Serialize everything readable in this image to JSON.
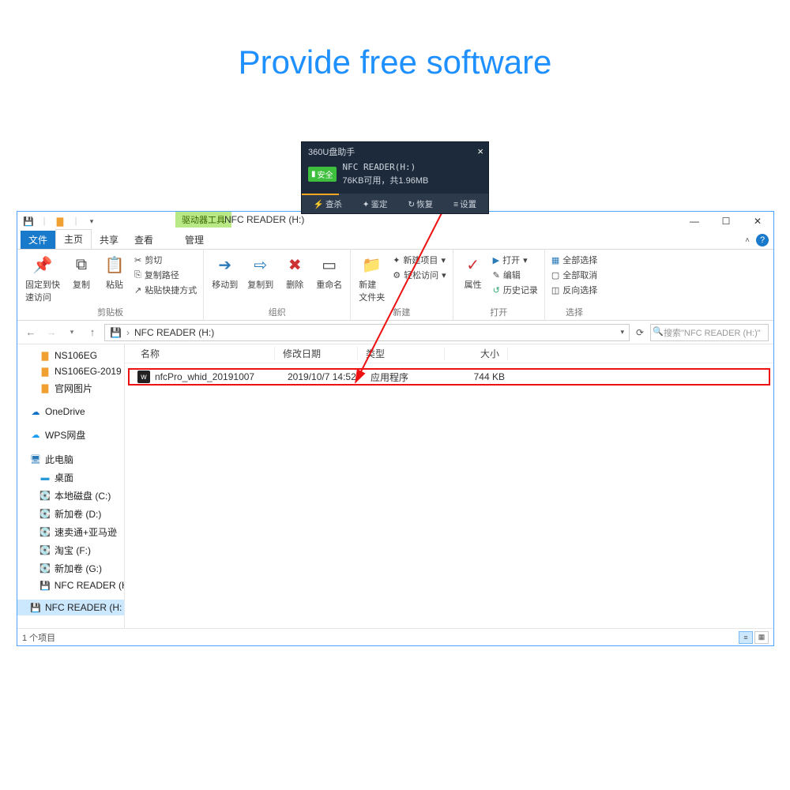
{
  "heading": "Provide free software",
  "popup": {
    "title": "360U盘助手",
    "badge": "安全",
    "line1": "NFC READER(H:)",
    "line2": "76KB可用，共1.96MB",
    "actions": {
      "scan": "查杀",
      "identify": "鉴定",
      "restore": "恢复",
      "settings": "设置"
    }
  },
  "window": {
    "driveToolsLabel": "驱动器工具",
    "title": "NFC READER (H:)",
    "tabs": {
      "file": "文件",
      "home": "主页",
      "share": "共享",
      "view": "查看",
      "manage": "管理"
    }
  },
  "ribbon": {
    "pin": "固定到快\n速访问",
    "copy": "复制",
    "paste": "粘贴",
    "cut": "剪切",
    "copyPath": "复制路径",
    "pasteShortcut": "粘贴快捷方式",
    "group1": "剪贴板",
    "moveTo": "移动到",
    "copyTo": "复制到",
    "delete": "删除",
    "rename": "重命名",
    "group2": "组织",
    "newFolder": "新建\n文件夹",
    "newItem": "新建项目",
    "easyAccess": "轻松访问",
    "group3": "新建",
    "properties": "属性",
    "open": "打开",
    "edit": "编辑",
    "history": "历史记录",
    "group4": "打开",
    "selectAll": "全部选择",
    "selectNone": "全部取消",
    "invert": "反向选择",
    "group5": "选择"
  },
  "address": {
    "path": "NFC READER (H:)",
    "searchPlaceholder": "搜索\"NFC READER (H:)\""
  },
  "tree": {
    "n1": "NS106EG",
    "n2": "NS106EG-2019",
    "n3": "官网图片",
    "n4": "OneDrive",
    "n5": "WPS网盘",
    "n6": "此电脑",
    "n7": "桌面",
    "n8": "本地磁盘 (C:)",
    "n9": "新加卷 (D:)",
    "n10": "速卖通+亚马逊",
    "n11": "淘宝 (F:)",
    "n12": "新加卷 (G:)",
    "n13": "NFC READER (H",
    "n14": "NFC READER (H:"
  },
  "columns": {
    "name": "名称",
    "date": "修改日期",
    "type": "类型",
    "size": "大小"
  },
  "file": {
    "name": "nfcPro_whid_20191007",
    "date": "2019/10/7 14:52",
    "type": "应用程序",
    "size": "744 KB"
  },
  "status": "1 个项目"
}
